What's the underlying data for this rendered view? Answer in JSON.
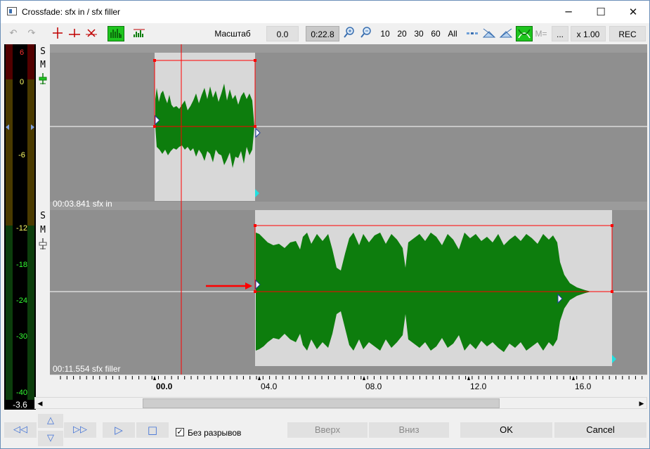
{
  "window": {
    "title": "Crossfade: sfx in / sfx filler"
  },
  "titlebar_buttons": {
    "minimize": "─",
    "maximize": "☐",
    "close": "✕"
  },
  "toolbar": {
    "undo_glyph": "↶",
    "redo_glyph": "↷",
    "scale_label": "Масштаб (дБ):",
    "scale_value": "0.0",
    "duration": "0:22.8",
    "zoom_presets": [
      "10",
      "20",
      "30",
      "60",
      "All"
    ],
    "m_equal_label": "M=",
    "dots_label": "...",
    "speed_label": "x 1.00",
    "rec_label": "REC"
  },
  "meter": {
    "labels": [
      "6",
      "0",
      "-6",
      "-12",
      "-18",
      "-24",
      "-30",
      "-40"
    ],
    "bottom_value": "-3.6",
    "colors": {
      "red": "#c00000",
      "yellow": "#a08000",
      "green": "#00aa00"
    }
  },
  "tracks": [
    {
      "solo": "S",
      "mute": "M",
      "clip_label": "00:03.841 sfx in"
    },
    {
      "solo": "S",
      "mute": "M",
      "clip_label": "00:11.554 sfx filler"
    }
  ],
  "ruler": {
    "labels": [
      "00.0",
      "04.0",
      "08.0",
      "12.0",
      "16.0"
    ]
  },
  "transport": {
    "rewind_glyph": "◁◁",
    "forward_glyph": "▷▷",
    "up_glyph": "△",
    "down_glyph": "▽",
    "play_glyph": "▷",
    "stop_glyph": "□"
  },
  "options": {
    "no_gaps_label": "Без разрывов",
    "no_gaps_checked": true,
    "check_glyph": "✓"
  },
  "buttons": {
    "up": "Вверх",
    "down": "Вниз",
    "ok": "OK",
    "cancel": "Cancel"
  },
  "colors": {
    "waveform": "#0d7d0d",
    "selection": "#ff0000",
    "accent_on": "#1ec41e"
  }
}
